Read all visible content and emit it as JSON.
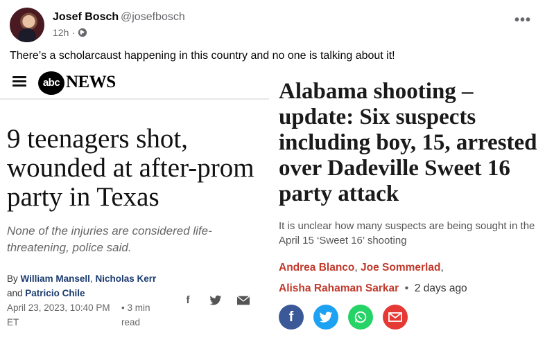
{
  "post": {
    "author": "Josef Bosch",
    "handle": "@josefbosch",
    "time": "12h",
    "separator": "·",
    "text": "There’s a scholarcaust happening in this country and no one is talking about it!"
  },
  "left_article": {
    "logo_text": "abc",
    "brand": "NEWS",
    "headline": "9 teenagers shot, wounded at after-prom party in Texas",
    "subheadline": "None of the injuries are considered life-threatening, police said.",
    "by_prefix": "By",
    "author1": "William Mansell",
    "author2": "Nicholas Kerr",
    "and": "and",
    "author3": "Patricio Chile",
    "date": "April 23, 2023, 10:40 PM",
    "tz": "ET",
    "read_time": "• 3 min read",
    "share_icons": [
      "facebook-icon",
      "twitter-icon",
      "email-icon"
    ]
  },
  "right_article": {
    "headline": "Alabama shooting – update: Six suspects including boy, 15, arrested over Dadeville Sweet 16 party attack",
    "subheadline": "It is unclear how many suspects are being sought in the April 15 ‘Sweet 16’ shooting",
    "author1": "Andrea Blanco",
    "author2": "Joe Sommerlad",
    "author3": "Alisha Rahaman Sarkar",
    "time_ago": "2 days ago",
    "share_buttons": [
      {
        "name": "facebook",
        "color": "#3b5998"
      },
      {
        "name": "twitter",
        "color": "#1da1f2"
      },
      {
        "name": "whatsapp",
        "color": "#25d366"
      },
      {
        "name": "email",
        "color": "#e53935"
      }
    ]
  },
  "colors": {
    "link_blue": "#1a3a6e",
    "author_red": "#c0392b",
    "muted": "#65676b"
  }
}
